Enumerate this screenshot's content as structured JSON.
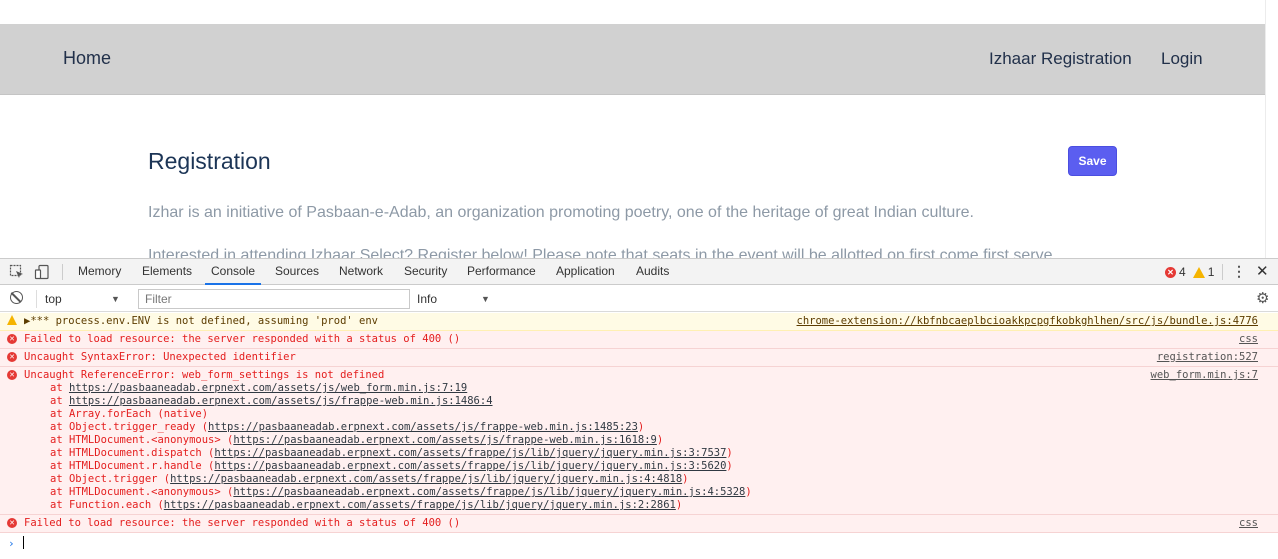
{
  "nav": {
    "home": "Home",
    "registration": "Izhaar Registration",
    "login": "Login"
  },
  "form": {
    "title": "Registration",
    "save_label": "Save",
    "intro": "Izhar is an initiative of Pasbaan-e-Adab, an organization promoting poetry, one of the heritage of great Indian culture.",
    "intro2": "Interested in attending Izhaar Select? Register below! Please note that seats in the event will be allotted on first come first serve"
  },
  "devtools": {
    "tabs": [
      "Memory",
      "Elements",
      "Console",
      "Sources",
      "Network",
      "Security",
      "Performance",
      "Application",
      "Audits"
    ],
    "active_tab": "Console",
    "error_count": "4",
    "warning_count": "1",
    "context": "top",
    "filter_placeholder": "Filter",
    "level": "Info"
  },
  "console": {
    "messages": [
      {
        "level": "warning",
        "text": "▶*** process.env.ENV is not defined, assuming 'prod' env",
        "source": "chrome-extension://kbfnbcaeplbcioakkpcpgfkobkghlhen/src/js/bundle.js:4776"
      },
      {
        "level": "error",
        "text": "Failed to load resource: the server responded with a status of 400 ()",
        "source": "css"
      },
      {
        "level": "error",
        "text": "Uncaught SyntaxError: Unexpected identifier",
        "source": "registration:527"
      },
      {
        "level": "error",
        "text": "Uncaught ReferenceError: web_form_settings is not defined",
        "source": "web_form.min.js:7",
        "trace": [
          {
            "prefix": "at ",
            "link": "https://pasbaaneadab.erpnext.com/assets/js/web_form.min.js:7:19",
            "suffix": ""
          },
          {
            "prefix": "at ",
            "link": "https://pasbaaneadab.erpnext.com/assets/js/frappe-web.min.js:1486:4",
            "suffix": ""
          },
          {
            "prefix": "at Array.forEach (native)",
            "link": "",
            "suffix": ""
          },
          {
            "prefix": "at Object.trigger_ready (",
            "link": "https://pasbaaneadab.erpnext.com/assets/js/frappe-web.min.js:1485:23",
            "suffix": ")"
          },
          {
            "prefix": "at HTMLDocument.<anonymous> (",
            "link": "https://pasbaaneadab.erpnext.com/assets/js/frappe-web.min.js:1618:9",
            "suffix": ")"
          },
          {
            "prefix": "at HTMLDocument.dispatch (",
            "link": "https://pasbaaneadab.erpnext.com/assets/frappe/js/lib/jquery/jquery.min.js:3:7537",
            "suffix": ")"
          },
          {
            "prefix": "at HTMLDocument.r.handle (",
            "link": "https://pasbaaneadab.erpnext.com/assets/frappe/js/lib/jquery/jquery.min.js:3:5620",
            "suffix": ")"
          },
          {
            "prefix": "at Object.trigger (",
            "link": "https://pasbaaneadab.erpnext.com/assets/frappe/js/lib/jquery/jquery.min.js:4:4818",
            "suffix": ")"
          },
          {
            "prefix": "at HTMLDocument.<anonymous> (",
            "link": "https://pasbaaneadab.erpnext.com/assets/frappe/js/lib/jquery/jquery.min.js:4:5328",
            "suffix": ")"
          },
          {
            "prefix": "at Function.each (",
            "link": "https://pasbaaneadab.erpnext.com/assets/frappe/js/lib/jquery/jquery.min.js:2:2861",
            "suffix": ")"
          }
        ]
      },
      {
        "level": "error",
        "text": "Failed to load resource: the server responded with a status of 400 ()",
        "source": "css"
      }
    ]
  },
  "colors": {
    "navbar": "#d1d1d1",
    "save_button": "#5b5ef0",
    "error_text": "#e41e1e",
    "error_bg": "#fff0f0",
    "warning_bg": "#fffbe5"
  }
}
